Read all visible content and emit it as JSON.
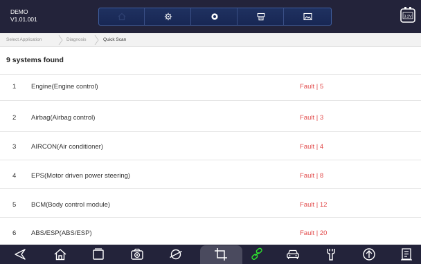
{
  "app": {
    "name": "DEMO",
    "version": "V1.01.001"
  },
  "battery": {
    "voltage": "3.2V"
  },
  "toolbar": {
    "buttons": [
      "home",
      "settings",
      "record",
      "print",
      "screenshot"
    ]
  },
  "breadcrumb": [
    "Select Application",
    "Diagnosis",
    "Quick Scan"
  ],
  "summary": "9 systems found",
  "systems": [
    {
      "num": "1",
      "name": "Engine(Engine control)",
      "status": "Fault | 5"
    },
    {
      "num": "2",
      "name": "Airbag(Airbag control)",
      "status": "Fault | 3"
    },
    {
      "num": "3",
      "name": "AIRCON(Air conditioner)",
      "status": "Fault | 4"
    },
    {
      "num": "4",
      "name": "EPS(Motor driven power steering)",
      "status": "Fault | 8"
    },
    {
      "num": "5",
      "name": "BCM(Body control module)",
      "status": "Fault | 12"
    },
    {
      "num": "6",
      "name": "ABS/ESP(ABS/ESP)",
      "status": "Fault | 20"
    }
  ],
  "colors": {
    "fault": "#e24c4c",
    "topbar": "#23233a",
    "accent": "#2ee62e"
  },
  "navbar": {
    "icons": [
      "back-icon",
      "home-icon",
      "recent-apps-icon",
      "camera-icon",
      "browser-icon",
      "crop-icon",
      "link-icon",
      "car-icon",
      "wrench-icon",
      "upload-icon",
      "report-icon"
    ]
  }
}
